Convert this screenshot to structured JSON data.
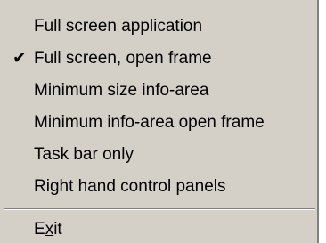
{
  "menu": {
    "items": [
      {
        "label": "Full screen application",
        "checked": false
      },
      {
        "label": "Full screen, open frame",
        "checked": true
      },
      {
        "label": "Minimum size info-area",
        "checked": false
      },
      {
        "label": "Minimum info-area open frame",
        "checked": false
      },
      {
        "label": "Task bar only",
        "checked": false
      },
      {
        "label": "Right hand control panels",
        "checked": false
      }
    ],
    "exit": {
      "label_pre": "E",
      "label_mnemonic": "x",
      "label_post": "it"
    }
  },
  "icons": {
    "check": "checkmark-icon"
  },
  "colors": {
    "menu_bg": "#d4d0c8",
    "text": "#000000",
    "separator_dark": "#808080",
    "separator_light": "#ffffff"
  }
}
